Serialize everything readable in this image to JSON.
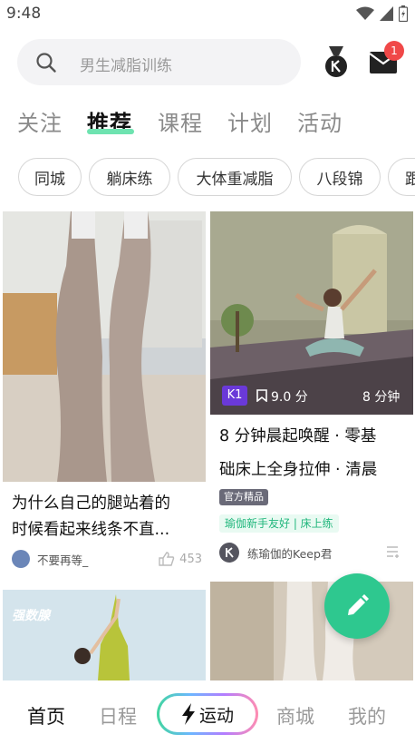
{
  "status_bar": {
    "time": "9:48"
  },
  "search": {
    "placeholder": "男生减脂训练"
  },
  "mail": {
    "badge_count": "1"
  },
  "tabs": [
    {
      "label": "关注",
      "active": false
    },
    {
      "label": "推荐",
      "active": true
    },
    {
      "label": "课程",
      "active": false
    },
    {
      "label": "计划",
      "active": false
    },
    {
      "label": "活动",
      "active": false
    }
  ],
  "chips": [
    "同城",
    "躺床练",
    "大体重减脂",
    "八段锦",
    "跟"
  ],
  "feed": [
    {
      "title_line1": "为什么自己的腿站着的",
      "title_line2": "时候看起来线条不直...",
      "author": "不要再等_",
      "likes": "453"
    },
    {
      "badge": "K1",
      "score": "9.0 分",
      "duration": "8 分钟",
      "title_line1": "8 分钟晨起唤醒 · 零基",
      "title_line2": "础床上全身拉伸 · 清晨",
      "tag_official": "官方精品",
      "tag_green": "瑜伽新手友好 | 床上练",
      "author": "练瑜伽的Keep君"
    },
    {
      "image_text": "强数腺"
    },
    {}
  ],
  "bottom_nav": {
    "home": "首页",
    "schedule": "日程",
    "sport": "运动",
    "mall": "商城",
    "me": "我的"
  },
  "colors": {
    "accent_green": "#2ec88f",
    "tab_underline": "#6ee3b0",
    "badge_red": "#f04848",
    "k1_purple": "#6a39d8"
  },
  "icons": [
    "search-icon",
    "medal-icon",
    "mail-icon",
    "pencil-icon",
    "lightning-icon",
    "like-icon",
    "more-list-icon",
    "wifi-icon",
    "signal-icon",
    "battery-icon"
  ]
}
